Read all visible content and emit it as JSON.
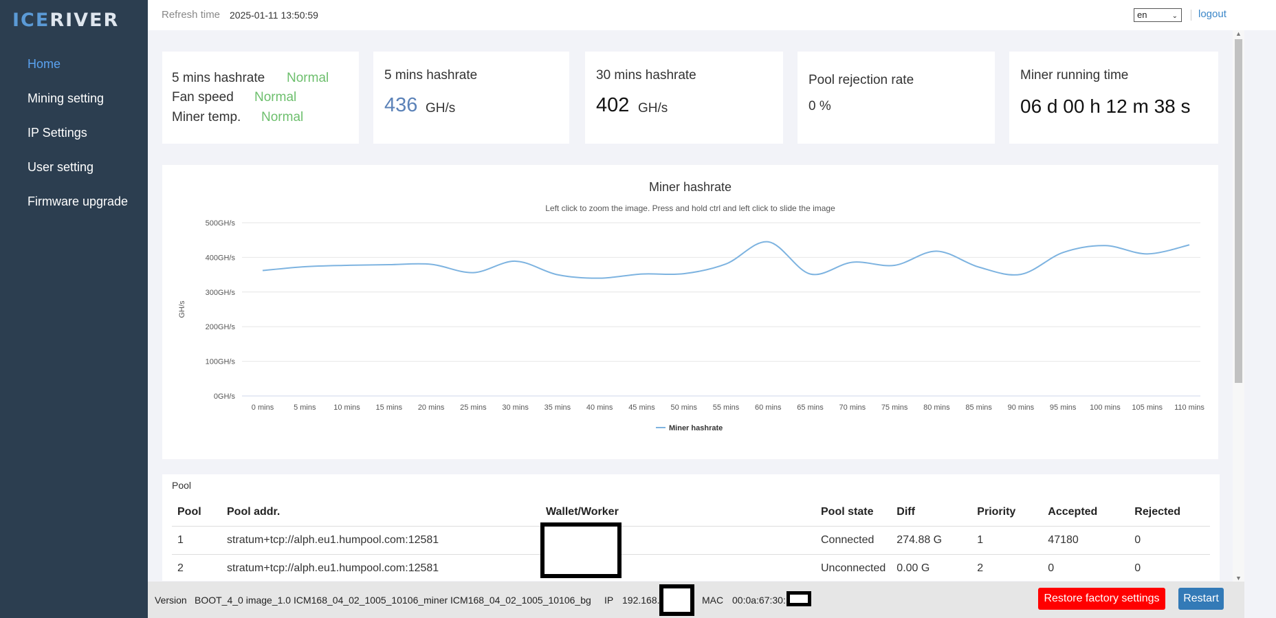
{
  "brand": {
    "logo_prefix": "ICE",
    "logo_suffix": "RIVER"
  },
  "sidebar": {
    "items": [
      {
        "label": "Home",
        "active": true
      },
      {
        "label": "Mining setting"
      },
      {
        "label": "IP Settings"
      },
      {
        "label": "User setting"
      },
      {
        "label": "Firmware upgrade"
      }
    ]
  },
  "header": {
    "refresh_label": "Refresh time",
    "refresh_time": "2025-01-11 13:50:59",
    "language": "en",
    "logout": "logout"
  },
  "status_card": {
    "rows": [
      {
        "label": "5 mins hashrate",
        "value": "Normal"
      },
      {
        "label": "Fan speed",
        "value": "Normal"
      },
      {
        "label": "Miner temp.",
        "value": "Normal"
      }
    ]
  },
  "hashrate_5": {
    "title": "5 mins hashrate",
    "value": "436",
    "unit": "GH/s"
  },
  "hashrate_30": {
    "title": "30 mins hashrate",
    "value": "402",
    "unit": "GH/s"
  },
  "pool_rejection": {
    "title": "Pool rejection rate",
    "value": "0 %"
  },
  "running_time": {
    "title": "Miner running time",
    "value": "06 d 00 h 12 m 38 s"
  },
  "chart_data": {
    "type": "line",
    "title": "Miner hashrate",
    "subtitle": "Left click to zoom the image. Press and hold ctrl and left click to slide the image",
    "ylabel": "GH/s",
    "xlabel": "",
    "ylim": [
      0,
      500
    ],
    "yticks": [
      "0GH/s",
      "100GH/s",
      "200GH/s",
      "300GH/s",
      "400GH/s",
      "500GH/s"
    ],
    "categories": [
      "0 mins",
      "5 mins",
      "10 mins",
      "15 mins",
      "20 mins",
      "25 mins",
      "30 mins",
      "35 mins",
      "40 mins",
      "45 mins",
      "50 mins",
      "55 mins",
      "60 mins",
      "65 mins",
      "70 mins",
      "75 mins",
      "80 mins",
      "85 mins",
      "90 mins",
      "95 mins",
      "100 mins",
      "105 mins",
      "110 mins"
    ],
    "series": [
      {
        "name": "Miner hashrate",
        "color": "#7db3e0",
        "values": [
          362,
          373,
          377,
          379,
          380,
          356,
          389,
          350,
          340,
          352,
          353,
          381,
          445,
          352,
          386,
          377,
          418,
          372,
          351,
          414,
          434,
          410,
          436
        ]
      }
    ],
    "legend_position": "bottom-center",
    "grid": true
  },
  "pool": {
    "label": "Pool",
    "headers": [
      "Pool",
      "Pool addr.",
      "Wallet/Worker",
      "Pool state",
      "Diff",
      "Priority",
      "Accepted",
      "Rejected"
    ],
    "rows": [
      {
        "pool": "1",
        "addr": "stratum+tcp://alph.eu1.humpool.com:12581",
        "wallet": "",
        "state": "Connected",
        "diff": "274.88 G",
        "priority": "1",
        "accepted": "47180",
        "rejected": "0"
      },
      {
        "pool": "2",
        "addr": "stratum+tcp://alph.eu1.humpool.com:12581",
        "wallet": "",
        "state": "Unconnected",
        "diff": "0.00 G",
        "priority": "2",
        "accepted": "0",
        "rejected": "0"
      }
    ]
  },
  "footer": {
    "version_label": "Version",
    "version": "BOOT_4_0 image_1.0 ICM168_04_02_1005_10106_miner ICM168_04_02_1005_10106_bg",
    "ip_label": "IP",
    "ip": "192.168.",
    "mac_label": "MAC",
    "mac": "00:0a:67:30:",
    "restore_label": "Restore factory settings",
    "restart_label": "Restart"
  },
  "colors": {
    "sidebar": "#2c3e50",
    "accent": "#5aa2f0",
    "ok": "#6dbf6d",
    "error": "#d23b2b",
    "danger_button": "#ff0000",
    "primary_button": "#337ab7"
  }
}
